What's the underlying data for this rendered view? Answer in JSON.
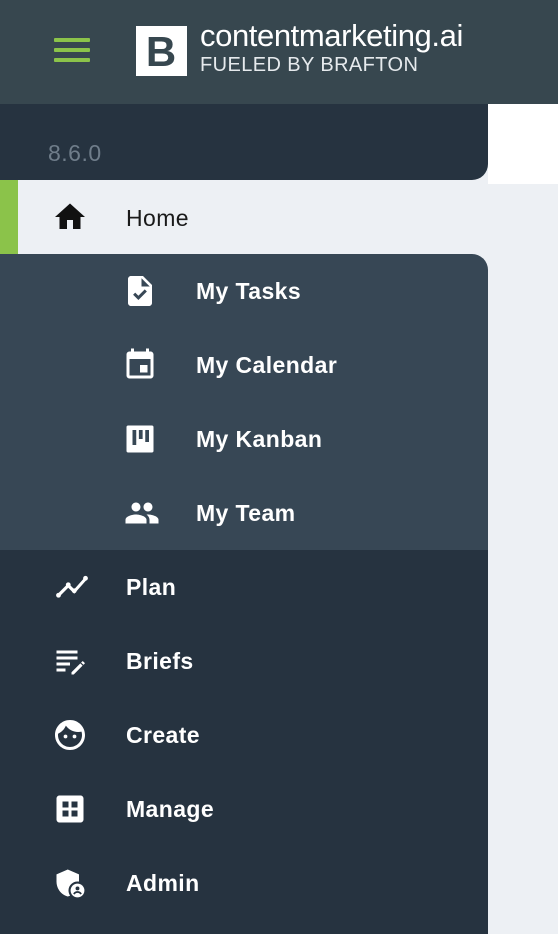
{
  "header": {
    "logo_mark": "B",
    "title": "contentmarketing.ai",
    "subtitle": "FUELED BY BRAFTON",
    "menu_icon": "hamburger-icon"
  },
  "version": "8.6.0",
  "colors": {
    "accent": "#8bc34a",
    "header_bg": "#37474f",
    "sidebar_bg": "#263340",
    "submenu_bg": "#374755",
    "home_bg": "#edf0f4"
  },
  "nav": {
    "home": {
      "label": "Home",
      "icon": "home-icon"
    },
    "sub_items": [
      {
        "label": "My Tasks",
        "icon": "task-file-icon"
      },
      {
        "label": "My Calendar",
        "icon": "calendar-icon"
      },
      {
        "label": "My Kanban",
        "icon": "kanban-icon"
      },
      {
        "label": "My Team",
        "icon": "team-icon"
      }
    ],
    "items": [
      {
        "label": "Plan",
        "icon": "trend-line-icon"
      },
      {
        "label": "Briefs",
        "icon": "brief-edit-icon"
      },
      {
        "label": "Create",
        "icon": "face-icon"
      },
      {
        "label": "Manage",
        "icon": "grid-icon"
      },
      {
        "label": "Admin",
        "icon": "admin-shield-icon"
      }
    ]
  }
}
